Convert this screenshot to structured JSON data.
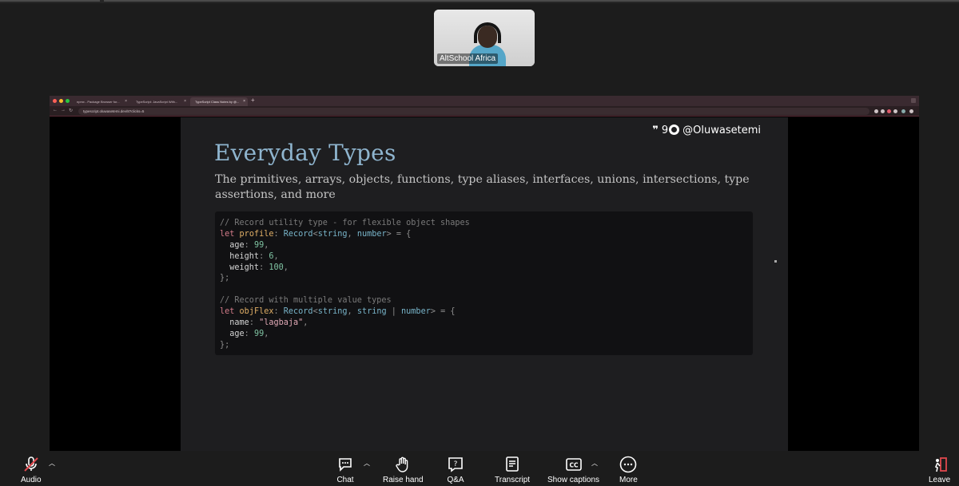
{
  "participant": {
    "name": "AltSchool Africa"
  },
  "browser": {
    "tabs": [
      {
        "title": "npmx - Package Browser for..."
      },
      {
        "title": "TypeScript: JavaScript With..."
      },
      {
        "title": "TypeScript Class Notes by @..."
      }
    ],
    "url": "typescript.oluwasetemi.dev/8?clicks=5"
  },
  "slide": {
    "brand_count": "9",
    "brand_handle": "@Oluwasetemi",
    "title": "Everyday Types",
    "subtitle": "The primitives, arrays, objects, functions, type aliases, interfaces, unions, intersections, type assertions, and more"
  },
  "code_lines": [
    [
      {
        "t": "// Record utility type - for flexible object shapes",
        "c": "com"
      }
    ],
    [
      {
        "t": "let ",
        "c": "kw"
      },
      {
        "t": "profile",
        "c": "var"
      },
      {
        "t": ": ",
        "c": "pun"
      },
      {
        "t": "Record",
        "c": "type"
      },
      {
        "t": "<",
        "c": "pun"
      },
      {
        "t": "string",
        "c": "type"
      },
      {
        "t": ", ",
        "c": "pun"
      },
      {
        "t": "number",
        "c": "type"
      },
      {
        "t": "> = {",
        "c": "pun"
      }
    ],
    [
      {
        "t": "  age",
        "c": "txt"
      },
      {
        "t": ": ",
        "c": "pun"
      },
      {
        "t": "99",
        "c": "num"
      },
      {
        "t": ",",
        "c": "pun"
      }
    ],
    [
      {
        "t": "  height",
        "c": "txt"
      },
      {
        "t": ": ",
        "c": "pun"
      },
      {
        "t": "6",
        "c": "num"
      },
      {
        "t": ",",
        "c": "pun"
      }
    ],
    [
      {
        "t": "  weight",
        "c": "txt"
      },
      {
        "t": ": ",
        "c": "pun"
      },
      {
        "t": "100",
        "c": "num"
      },
      {
        "t": ",",
        "c": "pun"
      }
    ],
    [
      {
        "t": "};",
        "c": "pun"
      }
    ],
    [],
    [
      {
        "t": "// Record with multiple value types",
        "c": "com"
      }
    ],
    [
      {
        "t": "let ",
        "c": "kw"
      },
      {
        "t": "objFlex",
        "c": "var"
      },
      {
        "t": ": ",
        "c": "pun"
      },
      {
        "t": "Record",
        "c": "type"
      },
      {
        "t": "<",
        "c": "pun"
      },
      {
        "t": "string",
        "c": "type"
      },
      {
        "t": ", ",
        "c": "pun"
      },
      {
        "t": "string",
        "c": "type"
      },
      {
        "t": " | ",
        "c": "pun"
      },
      {
        "t": "number",
        "c": "type"
      },
      {
        "t": "> = {",
        "c": "pun"
      }
    ],
    [
      {
        "t": "  name",
        "c": "txt"
      },
      {
        "t": ": ",
        "c": "pun"
      },
      {
        "t": "\"lagbaja\"",
        "c": "str"
      },
      {
        "t": ",",
        "c": "pun"
      }
    ],
    [
      {
        "t": "  age",
        "c": "txt"
      },
      {
        "t": ": ",
        "c": "pun"
      },
      {
        "t": "99",
        "c": "num"
      },
      {
        "t": ",",
        "c": "pun"
      }
    ],
    [
      {
        "t": "};",
        "c": "pun"
      }
    ]
  ],
  "controls": {
    "audio": "Audio",
    "chat": "Chat",
    "raise_hand": "Raise hand",
    "qa": "Q&A",
    "transcript": "Transcript",
    "captions": "Show captions",
    "more": "More",
    "leave": "Leave"
  },
  "colors": {
    "slide_bg": "#1e1e20",
    "title": "#8fb5cf",
    "leave_red": "#e0484e"
  }
}
